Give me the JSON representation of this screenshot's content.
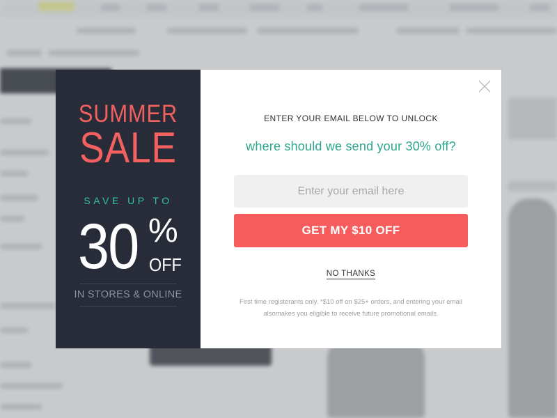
{
  "promo": {
    "headline_top": "SUMMER",
    "headline_bottom": "SALE",
    "save_up_to": "SAVE UP TO",
    "discount_number": "30",
    "percent_sign": "%",
    "off": "OFF",
    "channels": "IN STORES & ONLINE"
  },
  "form": {
    "instruction": "ENTER YOUR EMAIL BELOW TO UNLOCK",
    "question": "where should we send your 30% off?",
    "email_placeholder": "Enter your email here",
    "email_value": "",
    "cta_label": "GET MY $10 OFF",
    "decline_label": "NO THANKS",
    "fine_print": "First time registerants only. *$10 off on $25+ orders, and entering your email alsomakes you eligible to receive future promotional emails."
  },
  "colors": {
    "promo_background": "#272c38",
    "sale_accent": "#f26160",
    "teal_accent": "#2fc4a6",
    "question_text": "#2ea68d",
    "cta_background": "#f65c5c"
  },
  "icons": {
    "close": "close-icon"
  }
}
